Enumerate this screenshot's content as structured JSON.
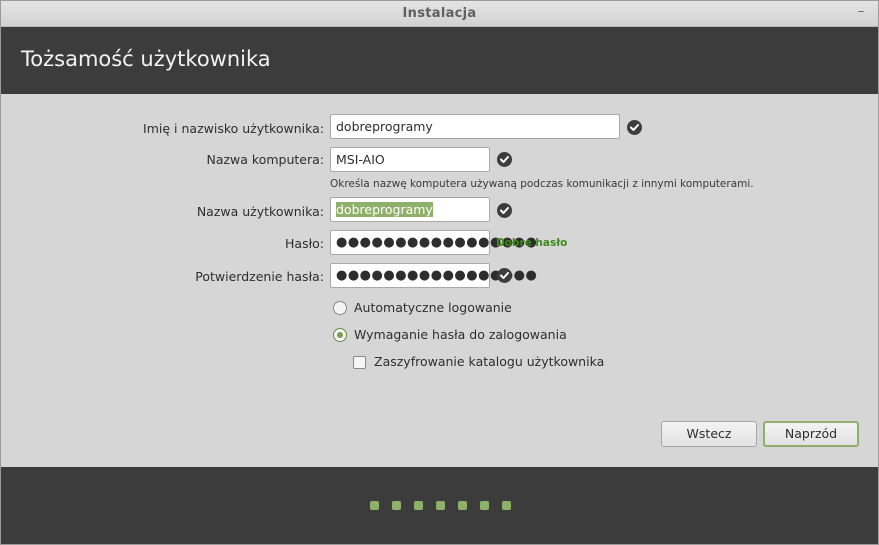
{
  "window": {
    "title": "Instalacja",
    "minimize_glyph": "–"
  },
  "header": {
    "title": "Tożsamość użytkownika"
  },
  "form": {
    "fullname": {
      "label": "Imię i nazwisko użytkownika:",
      "value": "dobreprogramy"
    },
    "computer": {
      "label": "Nazwa komputera:",
      "value": "MSI-AIO",
      "hint": "Określa nazwę komputera używaną podczas komunikacji z innymi komputerami."
    },
    "username": {
      "label": "Nazwa użytkownika:",
      "value": "dobreprogramy"
    },
    "password": {
      "label": "Hasło:",
      "value": "●●●●●●●●●●●●●●●●●",
      "strength": "Dobre hasło"
    },
    "confirm": {
      "label": "Potwierdzenie hasła:",
      "value": "●●●●●●●●●●●●●●●●●"
    }
  },
  "options": {
    "autologin": {
      "label": "Automatyczne logowanie",
      "selected": false
    },
    "require_password": {
      "label": "Wymaganie hasła do zalogowania",
      "selected": true
    },
    "encrypt_home": {
      "label": "Zaszyfrowanie katalogu użytkownika",
      "checked": false
    }
  },
  "buttons": {
    "back": "Wstecz",
    "next": "Naprzód"
  },
  "progress": {
    "steps_total": 7,
    "steps_shown": 7
  },
  "colors": {
    "accent": "#8fb06a",
    "header_bg": "#3c3c3c",
    "strength_text": "#3e8a1d"
  }
}
